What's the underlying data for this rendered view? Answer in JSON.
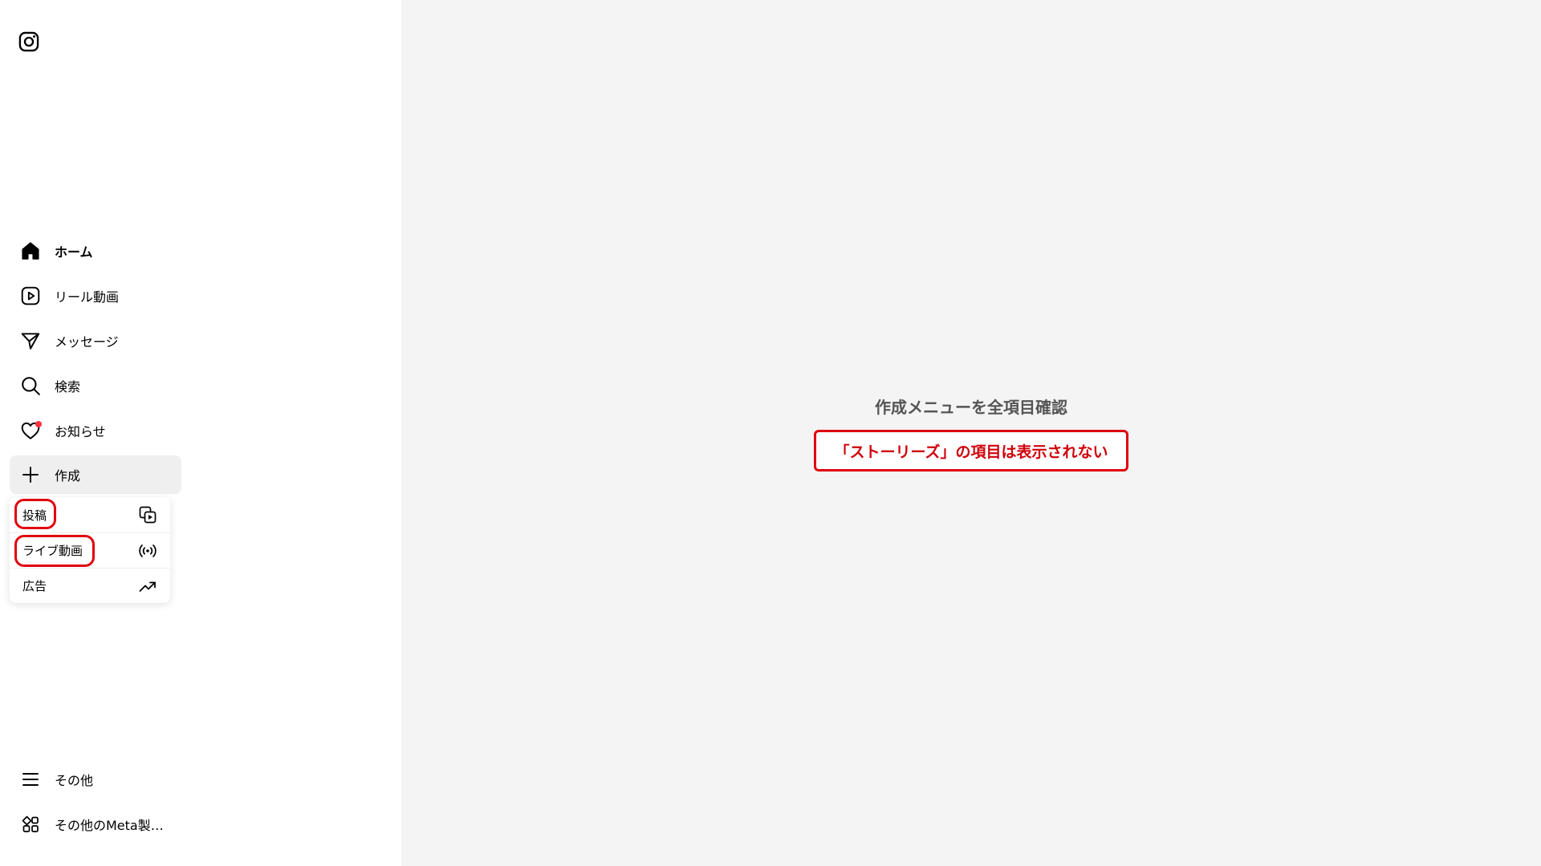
{
  "sidebar": {
    "logo": "instagram-logo-icon",
    "nav": [
      {
        "label": "ホーム",
        "icon": "home-icon"
      },
      {
        "label": "リール動画",
        "icon": "reels-icon"
      },
      {
        "label": "メッセージ",
        "icon": "send-icon"
      },
      {
        "label": "検索",
        "icon": "search-icon"
      },
      {
        "label": "お知らせ",
        "icon": "heart-icon"
      },
      {
        "label": "作成",
        "icon": "plus-icon"
      }
    ],
    "bottom": [
      {
        "label": "その他",
        "icon": "menu-icon"
      },
      {
        "label": "その他のMeta製ア...",
        "icon": "apps-icon"
      }
    ]
  },
  "create_menu": {
    "items": [
      {
        "label": "投稿",
        "icon": "post-media-icon"
      },
      {
        "label": "ライブ動画",
        "icon": "live-icon"
      },
      {
        "label": "広告",
        "icon": "trending-up-icon"
      }
    ]
  },
  "annotation": {
    "title": "作成メニューを全項目確認",
    "note": "「ストーリーズ」の項目は表示されない"
  },
  "colors": {
    "annotation_red": "#e0000f",
    "notification_dot": "#ff3040",
    "background": "#f4f4f4"
  }
}
